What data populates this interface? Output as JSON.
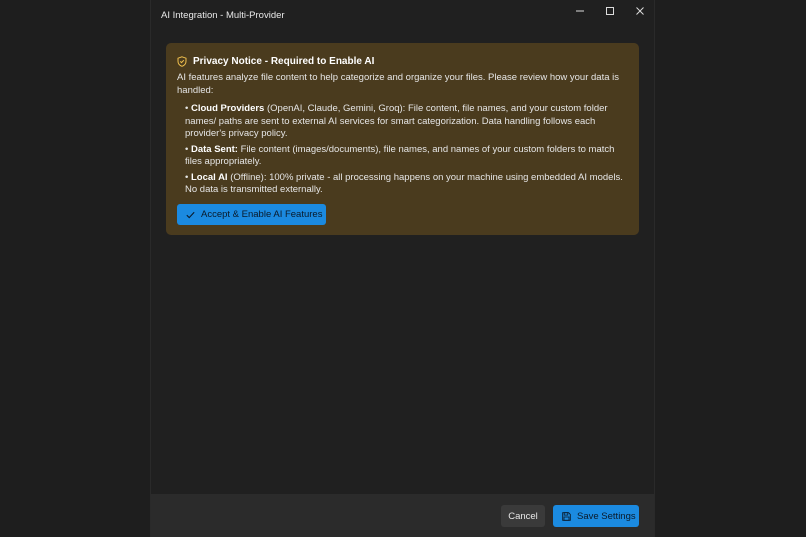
{
  "window": {
    "title": "AI Integration - Multi-Provider"
  },
  "notice": {
    "icon": "shield-icon",
    "title": "Privacy Notice - Required to Enable AI",
    "intro": "AI features analyze file content to help categorize and organize your files. Please review how your data is handled:",
    "bullets": [
      {
        "bold": "Cloud Providers",
        "text": " (OpenAI, Claude, Gemini, Groq): File content, file names, and your custom folder names/ paths are sent to external AI services for smart categorization. Data handling follows each provider's privacy policy."
      },
      {
        "bold": "Data Sent:",
        "text": " File content (images/documents), file names, and names of your custom folders to match files appropriately."
      },
      {
        "bold": "Local AI",
        "text": " (Offline): 100% private - all processing happens on your machine using embedded AI models. No data is transmitted externally."
      }
    ],
    "accept_label": "Accept & Enable AI Features"
  },
  "footer": {
    "cancel_label": "Cancel",
    "save_label": "Save Settings"
  },
  "colors": {
    "notice_bg": "#4a3b1e",
    "accent": "#1b8ae0",
    "shield": "#f2c14e"
  }
}
